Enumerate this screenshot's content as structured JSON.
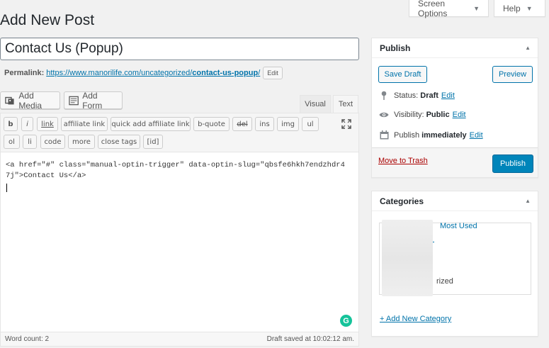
{
  "page": {
    "title": "Add New Post"
  },
  "screen_options": {
    "screen_options_label": "Screen Options",
    "help_label": "Help"
  },
  "post": {
    "title_value": "Contact Us (Popup)",
    "permalink_label": "Permalink:",
    "permalink_base": "https://www.manorilife.com/uncategorized/",
    "permalink_slug": "contact-us-popup",
    "permalink_suffix": "/",
    "permalink_edit": "Edit"
  },
  "media_buttons": {
    "add_media": "Add Media",
    "add_form": "Add Form"
  },
  "editor_tabs": {
    "visual": "Visual",
    "text": "Text",
    "active": "Text"
  },
  "quicktags": {
    "row1": [
      "b",
      "i",
      "link",
      "affiliate link",
      "quick add affiliate link",
      "b-quote",
      "del",
      "ins",
      "img",
      "ul"
    ],
    "row2": [
      "ol",
      "li",
      "code",
      "more",
      "close tags",
      "[id]"
    ]
  },
  "editor": {
    "content": "<a href=\"#\" class=\"manual-optin-trigger\" data-optin-slug=\"qbsfe6hkh7endzhdr47j\">Contact Us</a>",
    "word_count": "Word count: 2",
    "draft_saved": "Draft saved at 10:02:12 am."
  },
  "publish_box": {
    "title": "Publish",
    "save_draft": "Save Draft",
    "preview": "Preview",
    "status_label": "Status:",
    "status_value": "Draft",
    "visibility_label": "Visibility:",
    "visibility_value": "Public",
    "publish_label": "Publish",
    "publish_value": "immediately",
    "edit": "Edit",
    "move_to_trash": "Move to Trash",
    "publish_button": "Publish"
  },
  "categories_box": {
    "title": "Categories",
    "most_used": "Most Used",
    "partial_item": "rized",
    "add_new": "+ Add New Category"
  },
  "colors": {
    "accent": "#0073aa",
    "primary_button": "#0085ba",
    "trash": "#a00",
    "grammarly": "#15c39a"
  }
}
